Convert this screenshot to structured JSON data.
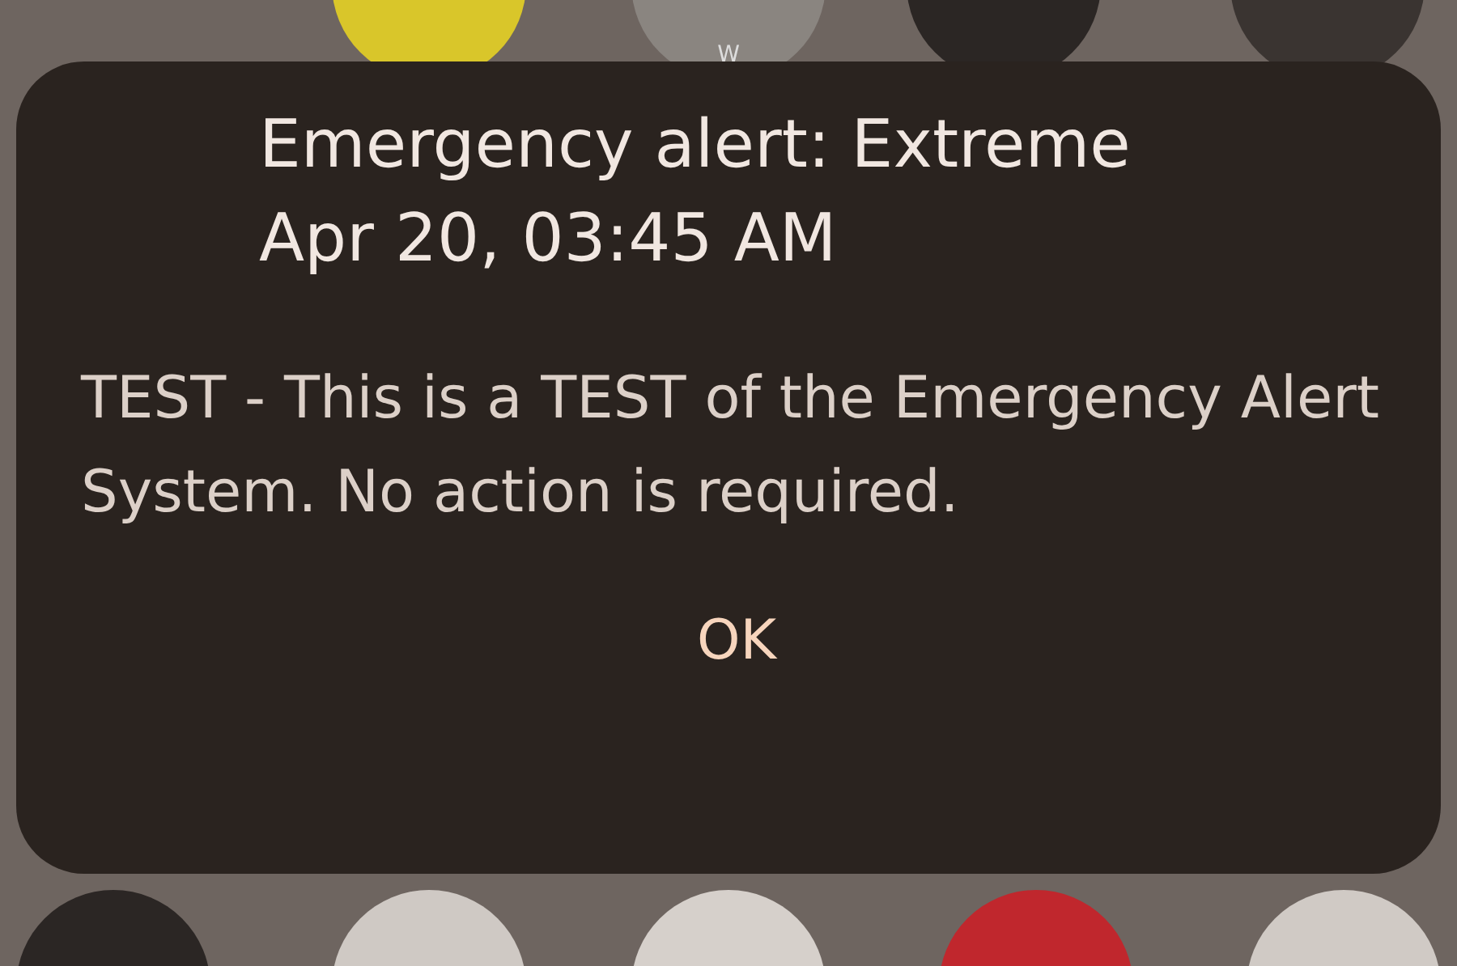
{
  "background": {
    "icon_letter": "W"
  },
  "alert": {
    "title": "Emergency alert: Extreme",
    "timestamp": "Apr 20, 03:45 AM",
    "message": "TEST - This is a TEST of the Emergency Alert System. No action is required.",
    "button": "OK"
  }
}
